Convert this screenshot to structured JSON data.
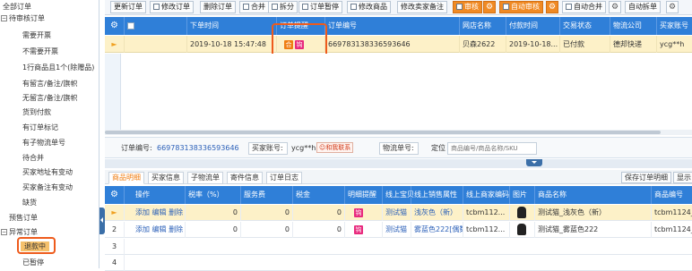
{
  "sidebar": {
    "items": [
      {
        "label": "全部订单",
        "toggle": ""
      },
      {
        "label": "待审核订单",
        "toggle": "−"
      },
      {
        "label": "需要开票",
        "toggle": ""
      },
      {
        "label": "不需要开票",
        "toggle": ""
      },
      {
        "label": "1行商品且1个(除赠品)",
        "toggle": ""
      },
      {
        "label": "有留言/备注/旗帜",
        "toggle": ""
      },
      {
        "label": "无留言/备注/旗帜",
        "toggle": ""
      },
      {
        "label": "货到付款",
        "toggle": ""
      },
      {
        "label": "有订单标记",
        "toggle": ""
      },
      {
        "label": "有子物流单号",
        "toggle": ""
      },
      {
        "label": "待合并",
        "toggle": ""
      },
      {
        "label": "买家地址有变动",
        "toggle": ""
      },
      {
        "label": "买家备注有变动",
        "toggle": ""
      },
      {
        "label": "缺货",
        "toggle": ""
      },
      {
        "label": "预售订单",
        "toggle": ""
      },
      {
        "label": "异常订单",
        "toggle": "−"
      },
      {
        "label": "退款中",
        "toggle": ""
      },
      {
        "label": "已暂停",
        "toggle": ""
      }
    ]
  },
  "toolbar": {
    "buttons": [
      "更新订单",
      "修改订单",
      "删除订单",
      "合并",
      "拆分",
      "订单暂停",
      "修改商品",
      "修改卖家备注",
      "审核",
      "自动审核",
      "自动合并",
      "自动拆单"
    ]
  },
  "grid": {
    "columns": [
      "下单时间",
      "订单提醒",
      "订单编号",
      "网店名称",
      "付款时间",
      "交易状态",
      "物流公司",
      "买家账号"
    ],
    "row": {
      "time": "2019-10-18 15:47:48",
      "badge1": "合",
      "badge2": "钩",
      "order_no": "669783138336593646",
      "shop": "贝森2622",
      "paid": "2019-10-18...",
      "status": "已付款",
      "logistics": "德邦快递",
      "buyer": "ycg**h"
    }
  },
  "info": {
    "order_label": "订单编号:",
    "order_value": "669783138336593646",
    "buyer_label": "买家账号:",
    "buyer_value": "ycg**h",
    "contact": "和我联系",
    "logistics_label": "物流单号:",
    "position_label": "定位",
    "position_placeholder": "商品编号/商品名称/SKU"
  },
  "subtabs": [
    "商品明细",
    "买家信息",
    "子物流单",
    "寄件信息",
    "订单日志"
  ],
  "sub_buttons": [
    "保存订单明细",
    "显示"
  ],
  "detail": {
    "columns": [
      "操作",
      "税率（%）",
      "服务费",
      "税金",
      "明细提醒",
      "线上宝贝",
      "线上销售属性",
      "线上商家编码",
      "图片",
      "商品名称",
      "商品编号"
    ],
    "rows": [
      {
        "no": "",
        "ops": "添加 编辑 删除",
        "tax_rate": "0",
        "fee": "0",
        "tax": "0",
        "badge": "钩",
        "online": "测试猫",
        "attr": "浅灰色（新）",
        "code": "tcbm112...",
        "name": "测试猫_浅灰色（新）",
        "sku": "tcbm1124_"
      },
      {
        "no": "2",
        "ops": "添加 编辑 删除",
        "tax_rate": "0",
        "fee": "0",
        "tax": "0",
        "badge": "钩",
        "online": "测试猫",
        "attr": "雾蓝色222[偶数]",
        "code": "tcbm112...",
        "name": "测试猫_雾蓝色222",
        "sku": "tcbm1124_"
      },
      {
        "no": "3"
      },
      {
        "no": "4"
      },
      {
        "no": "5"
      }
    ]
  }
}
